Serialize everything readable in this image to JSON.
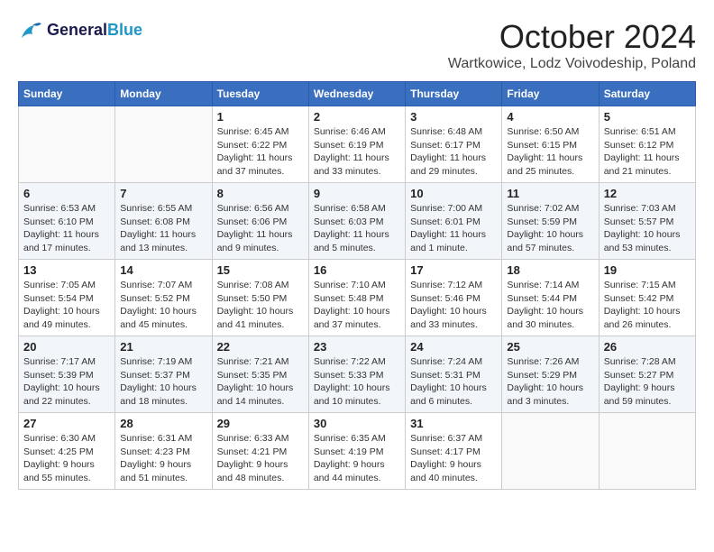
{
  "header": {
    "logo_line1": "General",
    "logo_line2": "Blue",
    "month": "October 2024",
    "location": "Wartkowice, Lodz Voivodeship, Poland"
  },
  "days_of_week": [
    "Sunday",
    "Monday",
    "Tuesday",
    "Wednesday",
    "Thursday",
    "Friday",
    "Saturday"
  ],
  "weeks": [
    [
      {
        "num": "",
        "info": ""
      },
      {
        "num": "",
        "info": ""
      },
      {
        "num": "1",
        "info": "Sunrise: 6:45 AM\nSunset: 6:22 PM\nDaylight: 11 hours and 37 minutes."
      },
      {
        "num": "2",
        "info": "Sunrise: 6:46 AM\nSunset: 6:19 PM\nDaylight: 11 hours and 33 minutes."
      },
      {
        "num": "3",
        "info": "Sunrise: 6:48 AM\nSunset: 6:17 PM\nDaylight: 11 hours and 29 minutes."
      },
      {
        "num": "4",
        "info": "Sunrise: 6:50 AM\nSunset: 6:15 PM\nDaylight: 11 hours and 25 minutes."
      },
      {
        "num": "5",
        "info": "Sunrise: 6:51 AM\nSunset: 6:12 PM\nDaylight: 11 hours and 21 minutes."
      }
    ],
    [
      {
        "num": "6",
        "info": "Sunrise: 6:53 AM\nSunset: 6:10 PM\nDaylight: 11 hours and 17 minutes."
      },
      {
        "num": "7",
        "info": "Sunrise: 6:55 AM\nSunset: 6:08 PM\nDaylight: 11 hours and 13 minutes."
      },
      {
        "num": "8",
        "info": "Sunrise: 6:56 AM\nSunset: 6:06 PM\nDaylight: 11 hours and 9 minutes."
      },
      {
        "num": "9",
        "info": "Sunrise: 6:58 AM\nSunset: 6:03 PM\nDaylight: 11 hours and 5 minutes."
      },
      {
        "num": "10",
        "info": "Sunrise: 7:00 AM\nSunset: 6:01 PM\nDaylight: 11 hours and 1 minute."
      },
      {
        "num": "11",
        "info": "Sunrise: 7:02 AM\nSunset: 5:59 PM\nDaylight: 10 hours and 57 minutes."
      },
      {
        "num": "12",
        "info": "Sunrise: 7:03 AM\nSunset: 5:57 PM\nDaylight: 10 hours and 53 minutes."
      }
    ],
    [
      {
        "num": "13",
        "info": "Sunrise: 7:05 AM\nSunset: 5:54 PM\nDaylight: 10 hours and 49 minutes."
      },
      {
        "num": "14",
        "info": "Sunrise: 7:07 AM\nSunset: 5:52 PM\nDaylight: 10 hours and 45 minutes."
      },
      {
        "num": "15",
        "info": "Sunrise: 7:08 AM\nSunset: 5:50 PM\nDaylight: 10 hours and 41 minutes."
      },
      {
        "num": "16",
        "info": "Sunrise: 7:10 AM\nSunset: 5:48 PM\nDaylight: 10 hours and 37 minutes."
      },
      {
        "num": "17",
        "info": "Sunrise: 7:12 AM\nSunset: 5:46 PM\nDaylight: 10 hours and 33 minutes."
      },
      {
        "num": "18",
        "info": "Sunrise: 7:14 AM\nSunset: 5:44 PM\nDaylight: 10 hours and 30 minutes."
      },
      {
        "num": "19",
        "info": "Sunrise: 7:15 AM\nSunset: 5:42 PM\nDaylight: 10 hours and 26 minutes."
      }
    ],
    [
      {
        "num": "20",
        "info": "Sunrise: 7:17 AM\nSunset: 5:39 PM\nDaylight: 10 hours and 22 minutes."
      },
      {
        "num": "21",
        "info": "Sunrise: 7:19 AM\nSunset: 5:37 PM\nDaylight: 10 hours and 18 minutes."
      },
      {
        "num": "22",
        "info": "Sunrise: 7:21 AM\nSunset: 5:35 PM\nDaylight: 10 hours and 14 minutes."
      },
      {
        "num": "23",
        "info": "Sunrise: 7:22 AM\nSunset: 5:33 PM\nDaylight: 10 hours and 10 minutes."
      },
      {
        "num": "24",
        "info": "Sunrise: 7:24 AM\nSunset: 5:31 PM\nDaylight: 10 hours and 6 minutes."
      },
      {
        "num": "25",
        "info": "Sunrise: 7:26 AM\nSunset: 5:29 PM\nDaylight: 10 hours and 3 minutes."
      },
      {
        "num": "26",
        "info": "Sunrise: 7:28 AM\nSunset: 5:27 PM\nDaylight: 9 hours and 59 minutes."
      }
    ],
    [
      {
        "num": "27",
        "info": "Sunrise: 6:30 AM\nSunset: 4:25 PM\nDaylight: 9 hours and 55 minutes."
      },
      {
        "num": "28",
        "info": "Sunrise: 6:31 AM\nSunset: 4:23 PM\nDaylight: 9 hours and 51 minutes."
      },
      {
        "num": "29",
        "info": "Sunrise: 6:33 AM\nSunset: 4:21 PM\nDaylight: 9 hours and 48 minutes."
      },
      {
        "num": "30",
        "info": "Sunrise: 6:35 AM\nSunset: 4:19 PM\nDaylight: 9 hours and 44 minutes."
      },
      {
        "num": "31",
        "info": "Sunrise: 6:37 AM\nSunset: 4:17 PM\nDaylight: 9 hours and 40 minutes."
      },
      {
        "num": "",
        "info": ""
      },
      {
        "num": "",
        "info": ""
      }
    ]
  ]
}
